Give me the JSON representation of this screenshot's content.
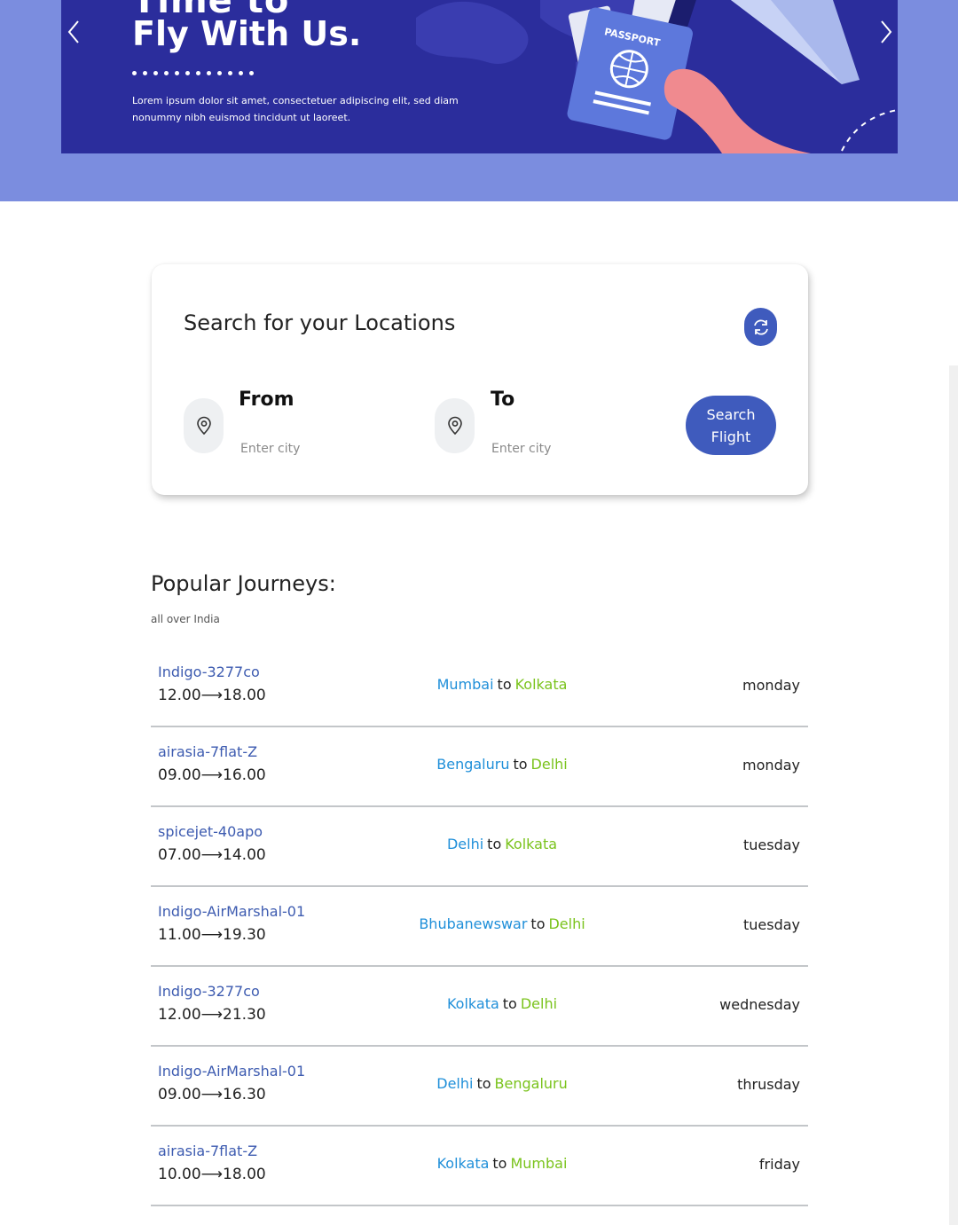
{
  "banner": {
    "heading_top": "Time to",
    "heading": "Fly With Us.",
    "text": "Lorem ipsum dolor sit amet, consectetuer adipiscing elit, sed diam nonummy nibh euismod tincidunt ut laoreet.",
    "passport_label": "PASSPORT",
    "prev_icon": "chevron-left-icon",
    "next_icon": "chevron-right-icon"
  },
  "search": {
    "title": "Search for your Locations",
    "swap_icon": "swap-icon",
    "from_label": "From",
    "from_placeholder": "Enter city",
    "to_label": "To",
    "to_placeholder": "Enter city",
    "button_label": "Search Flight"
  },
  "popular": {
    "title": "Popular Journeys:",
    "subtitle": "all over India",
    "connector": "to",
    "journeys": [
      {
        "code": "Indigo-3277co",
        "time": "12.00⟶18.00",
        "from": "Mumbai",
        "to": "Kolkata",
        "day": "monday"
      },
      {
        "code": "airasia-7flat-Z",
        "time": "09.00⟶16.00",
        "from": "Bengaluru",
        "to": "Delhi",
        "day": "monday"
      },
      {
        "code": "spicejet-40apo",
        "time": "07.00⟶14.00",
        "from": "Delhi",
        "to": "Kolkata",
        "day": "tuesday"
      },
      {
        "code": "Indigo-AirMarshal-01",
        "time": "11.00⟶19.30",
        "from": "Bhubanewswar",
        "to": "Delhi",
        "day": "tuesday"
      },
      {
        "code": "Indigo-3277co",
        "time": "12.00⟶21.30",
        "from": "Kolkata",
        "to": "Delhi",
        "day": "wednesday"
      },
      {
        "code": "Indigo-AirMarshal-01",
        "time": "09.00⟶16.30",
        "from": "Delhi",
        "to": "Bengaluru",
        "day": "thrusday"
      },
      {
        "code": "airasia-7flat-Z",
        "time": "10.00⟶18.00",
        "from": "Kolkata",
        "to": "Mumbai",
        "day": "friday"
      }
    ]
  },
  "colors": {
    "banner_bg": "#7b8ddf",
    "banner": "#2b2d9c",
    "primary": "#3f5bbd",
    "city_from": "#1f8fd9",
    "city_to": "#7ac31c"
  }
}
